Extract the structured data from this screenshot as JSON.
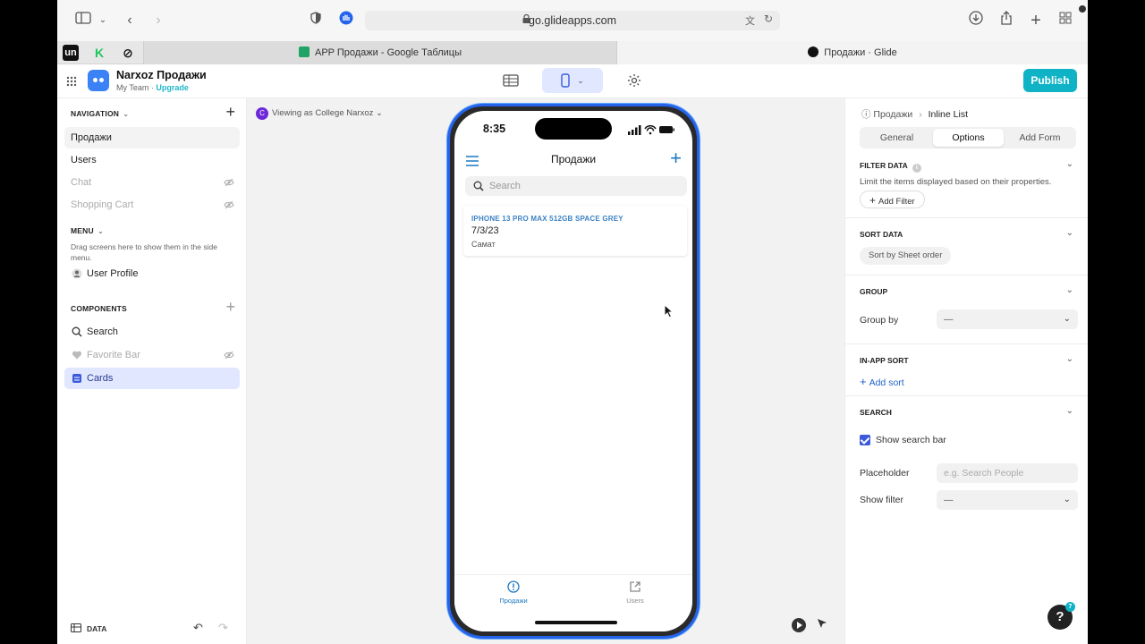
{
  "browser": {
    "url": "go.glideapps.com",
    "tabs": [
      {
        "title": "APP Продажи - Google Таблицы",
        "favicon_color": "#21a366"
      },
      {
        "title": "Продажи · Glide",
        "favicon_color": "#111111"
      }
    ]
  },
  "app": {
    "name": "Narxoz Продажи",
    "team": "My Team ·",
    "upgrade": "Upgrade",
    "publish_label": "Publish",
    "accent": "#10b3c6"
  },
  "sidebar": {
    "navigation_header": "NAVIGATION",
    "nav_items": [
      {
        "label": "Продажи",
        "selected": true,
        "hidden": false
      },
      {
        "label": "Users",
        "selected": false,
        "hidden": false
      },
      {
        "label": "Chat",
        "selected": false,
        "hidden": true
      },
      {
        "label": "Shopping Cart",
        "selected": false,
        "hidden": true
      }
    ],
    "menu_header": "MENU",
    "menu_hint": "Drag screens here to show them in the side menu.",
    "menu_items": [
      {
        "label": "User Profile"
      }
    ],
    "components_header": "COMPONENTS",
    "components": [
      {
        "label": "Search",
        "icon": "search-icon",
        "hidden": false
      },
      {
        "label": "Favorite Bar",
        "icon": "heart-icon",
        "hidden": true
      },
      {
        "label": "Cards",
        "icon": "cards-icon",
        "hidden": false,
        "selected": true
      }
    ],
    "data_label": "DATA"
  },
  "canvas": {
    "viewing_avatar": "C",
    "viewing_as": "Viewing as College Narxoz",
    "phone": {
      "time": "8:35",
      "title": "Продажи",
      "search_placeholder": "Search",
      "card": {
        "title": "IPHONE 13 PRO MAX 512GB SPACE GREY",
        "date": "7/3/23",
        "subtitle": "Самат"
      },
      "tabs": [
        {
          "label": "Продажи",
          "active": true
        },
        {
          "label": "Users",
          "active": false
        }
      ]
    }
  },
  "panel": {
    "breadcrumb_root": "Продажи",
    "breadcrumb_sep": "›",
    "breadcrumb_current": "Inline List",
    "tabs": [
      "General",
      "Options",
      "Add Form"
    ],
    "active_tab": "Options",
    "filter_header": "FILTER DATA",
    "filter_desc": "Limit the items displayed based on their properties.",
    "add_filter": "Add Filter",
    "sort_header": "SORT DATA",
    "sort_value": "Sort by Sheet order",
    "group_header": "GROUP",
    "group_by_label": "Group by",
    "group_by_value": "—",
    "inapp_header": "IN-APP SORT",
    "add_sort": "Add sort",
    "search_header": "SEARCH",
    "show_search_bar": "Show search bar",
    "show_search_checked": true,
    "placeholder_label": "Placeholder",
    "placeholder_hint": "e.g. Search People",
    "show_filter_label": "Show filter",
    "show_filter_value": "—",
    "help_badge": "7"
  }
}
